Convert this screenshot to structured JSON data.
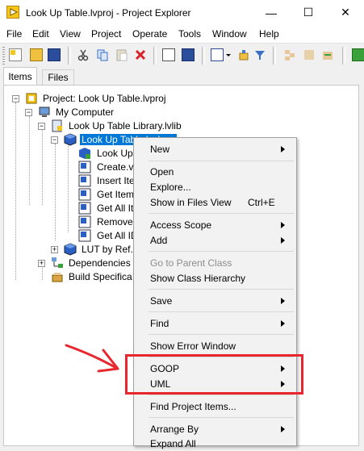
{
  "window": {
    "title": "Look Up Table.lvproj - Project Explorer"
  },
  "window_controls": {
    "minimize": "—",
    "maximize": "☐",
    "close": "✕"
  },
  "menu": [
    "File",
    "Edit",
    "View",
    "Project",
    "Operate",
    "Tools",
    "Window",
    "Help"
  ],
  "tabs": {
    "items": "Items",
    "files": "Files"
  },
  "tree": {
    "project": "Project: Look Up Table.lvproj",
    "my_computer": "My Computer",
    "library": "Look Up Table Library.lvlib",
    "class": "Look Up Table.lvclass",
    "children": [
      "Look Up",
      "Create.vi",
      "Insert Ite",
      "Get Item",
      "Get All It",
      "Remove",
      "Get All ID"
    ],
    "lut_by_ref": "LUT by Ref.",
    "dependencies": "Dependencies",
    "build_specs": "Build Specifica"
  },
  "context_menu": {
    "items": [
      {
        "label": "New",
        "submenu": true
      },
      {
        "label": "Open"
      },
      {
        "label": "Explore..."
      },
      {
        "label": "Show in Files View",
        "shortcut": "Ctrl+E"
      },
      {
        "label": "Access Scope",
        "submenu": true
      },
      {
        "label": "Add",
        "submenu": true
      },
      {
        "label": "Go to Parent Class",
        "disabled": true
      },
      {
        "label": "Show Class Hierarchy"
      },
      {
        "label": "Save",
        "submenu": true
      },
      {
        "label": "Find",
        "submenu": true
      },
      {
        "label": "Show Error Window"
      },
      {
        "label": "GOOP",
        "submenu": true
      },
      {
        "label": "UML",
        "submenu": true
      },
      {
        "label": "Find Project Items..."
      },
      {
        "label": "Arrange By",
        "submenu": true
      },
      {
        "label": "Expand All"
      }
    ]
  },
  "annotation": {
    "arrow_color": "#e8262d",
    "box_color": "#e8262d"
  }
}
